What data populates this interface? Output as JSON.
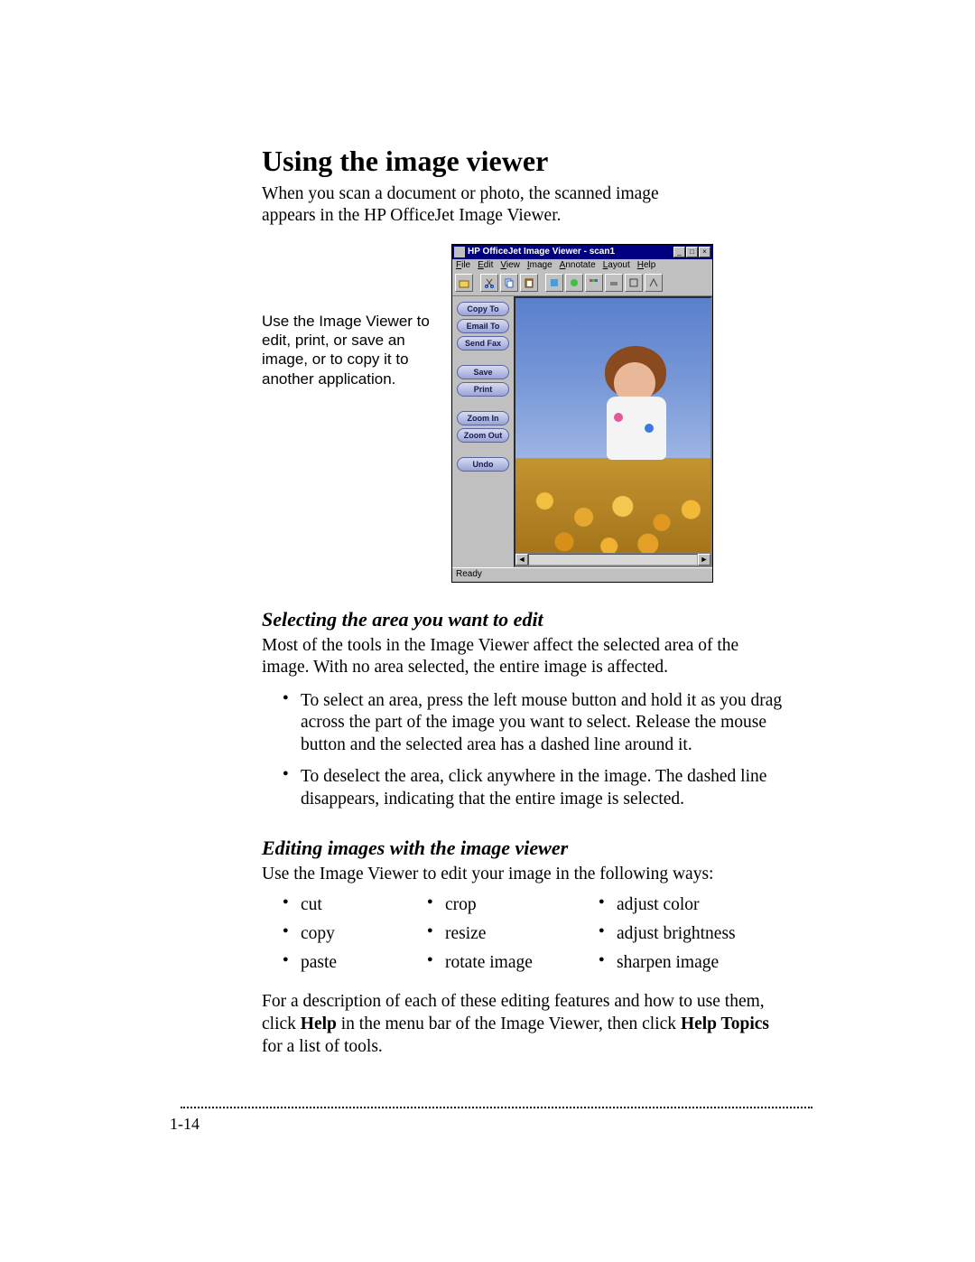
{
  "heading": "Using the image viewer",
  "intro": "When you scan a document or photo, the scanned image appears in the HP OfficeJet Image Viewer.",
  "caption": "Use the Image Viewer to edit, print, or save an image, or to copy it to another application.",
  "viewer": {
    "title": "HP OfficeJet Image Viewer - scan1",
    "menus": [
      "File",
      "Edit",
      "View",
      "Image",
      "Annotate",
      "Layout",
      "Help"
    ],
    "min_btn": "_",
    "max_btn": "□",
    "close_btn": "×",
    "sidebar_buttons": [
      "Copy To",
      "Email To",
      "Send Fax",
      "Save",
      "Print",
      "Zoom In",
      "Zoom Out",
      "Undo"
    ],
    "scroll_left": "◄",
    "scroll_right": "►",
    "status": "Ready"
  },
  "section1": {
    "heading": "Selecting the area you want to edit",
    "para": "Most of the tools in the Image Viewer affect the selected area of the image. With no area selected, the entire image is affected.",
    "bullets": [
      "To select an area, press the left mouse button and hold it as you drag across the part of the image you want to select. Release the mouse button and the selected area has a dashed line around it.",
      "To deselect the area, click anywhere in the image. The dashed line disappears, indicating that the entire image is selected."
    ]
  },
  "section2": {
    "heading": "Editing images with the image viewer",
    "para": "Use the Image Viewer to edit your image in the following ways:",
    "grid": [
      [
        "cut",
        "crop",
        "adjust color"
      ],
      [
        "copy",
        "resize",
        "adjust brightness"
      ],
      [
        "paste",
        "rotate image",
        "sharpen image"
      ]
    ],
    "closing_pre": "For a description of each of these editing features and how to use them, click ",
    "closing_b1": "Help",
    "closing_mid": " in the menu bar of the Image Viewer, then click ",
    "closing_b2": "Help Topics",
    "closing_post": " for a list of tools."
  },
  "page_number": "1-14"
}
